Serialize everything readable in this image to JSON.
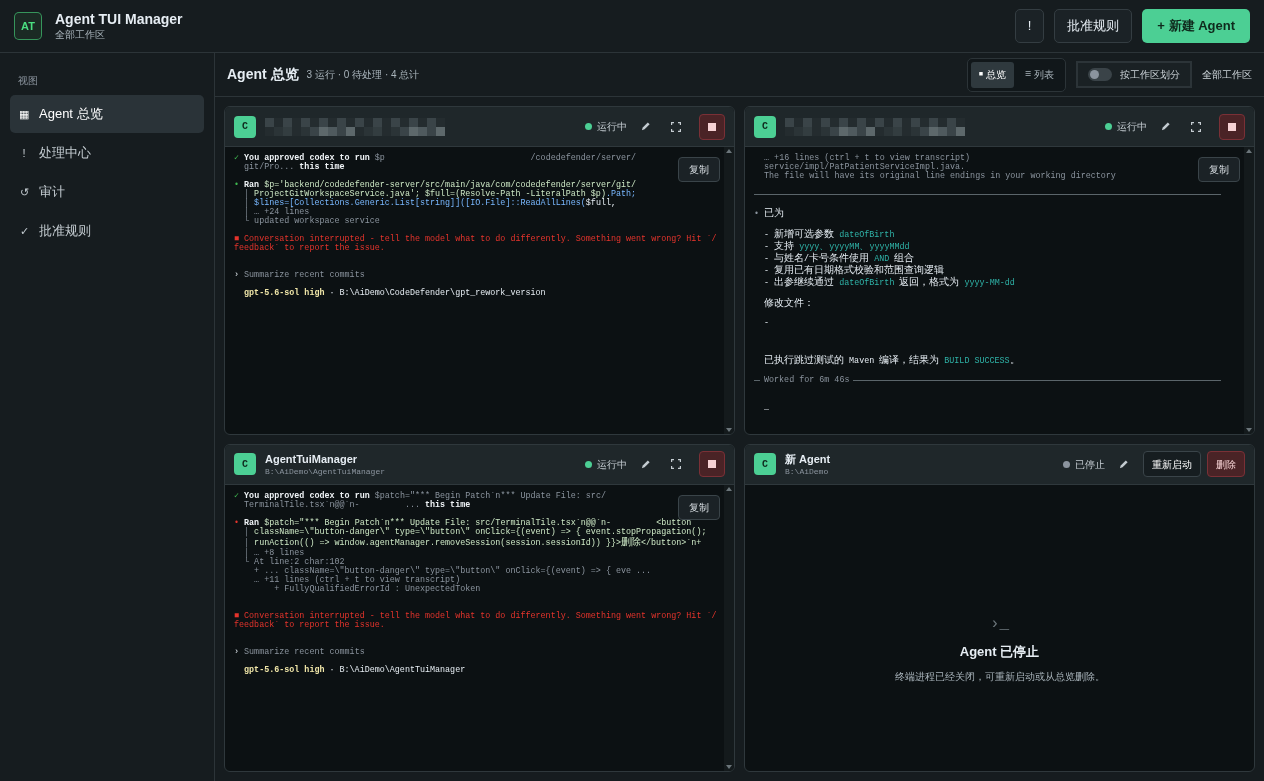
{
  "app": {
    "logo": "AT",
    "title": "Agent TUI Manager",
    "subtitle": "全部工作区"
  },
  "header_buttons": [
    {
      "label": "!",
      "kind": "plain"
    },
    {
      "label": "批准规则",
      "kind": "plain"
    },
    {
      "label": "+ 新建 Agent",
      "kind": "primary"
    }
  ],
  "sidebar": {
    "section": "视图",
    "items": [
      {
        "icon": "▦",
        "label": "Agent 总览",
        "selected": true
      },
      {
        "icon": "!",
        "label": "处理中心",
        "selected": false
      },
      {
        "icon": "↺",
        "label": "审计",
        "selected": false
      },
      {
        "icon": "✓",
        "label": "批准规则",
        "selected": false
      }
    ]
  },
  "toolbar": {
    "title": "Agent 总览",
    "summary": "3 运行 · 0 待处理 · 4 总计",
    "views": [
      {
        "icon": "■",
        "label": "总览",
        "selected": true
      },
      {
        "icon": "☰",
        "label": "列表",
        "selected": false
      }
    ],
    "group_toggle": {
      "label": "按工作区划分",
      "on": false
    },
    "workspace": "全部工作区"
  },
  "cards": [
    {
      "kind": "terminal",
      "avatar": "C",
      "redacted": true,
      "status": {
        "label": "运行中",
        "running": true
      },
      "copy": "复制",
      "lines": [
        {
          "kind": "text",
          "segments": [
            {
              "kind": "ok",
              "text": "✓ "
            },
            {
              "kind": "strong",
              "text": "You approved codex to run "
            },
            {
              "kind": "dim",
              "text": "$p                             /codedefender/server/"
            }
          ]
        },
        {
          "kind": "text",
          "segments": [
            {
              "kind": "dim",
              "text": "  git/Pro... "
            },
            {
              "kind": "strong",
              "text": "this time"
            }
          ]
        },
        {
          "kind": "blank"
        },
        {
          "kind": "text",
          "segments": [
            {
              "kind": "ok",
              "text": "• "
            },
            {
              "kind": "strong",
              "text": "Ran "
            },
            {
              "kind": "code",
              "text": "$p='backend/codedefender-server/src/main/java/com/codedefender/server/git/"
            }
          ]
        },
        {
          "kind": "text",
          "segments": [
            {
              "kind": "dim",
              "text": "  │ "
            },
            {
              "kind": "code",
              "text": "ProjectGitWorkspaceService.java'; $full=(Resolve-Path -LiteralPath $p)"
            },
            {
              "kind": "keyword",
              "text": ".Path;"
            }
          ]
        },
        {
          "kind": "text",
          "segments": [
            {
              "kind": "dim",
              "text": "  │ "
            },
            {
              "kind": "keyword",
              "text": "$lines=[Collections.Generic.List[string]]([IO.File]::ReadAllLines("
            },
            {
              "kind": "plain",
              "text": "$full,"
            }
          ]
        },
        {
          "kind": "text",
          "segments": [
            {
              "kind": "dim",
              "text": "  │ … +24 lines"
            }
          ]
        },
        {
          "kind": "text",
          "segments": [
            {
              "kind": "dim",
              "text": "  └ updated workspace service"
            }
          ]
        },
        {
          "kind": "blank"
        },
        {
          "kind": "text",
          "segments": [
            {
              "kind": "error",
              "text": "■ Conversation interrupted - tell the model what to do differently. Something went wrong? Hit `/"
            }
          ]
        },
        {
          "kind": "text",
          "segments": [
            {
              "kind": "error",
              "text": "feedback` to report the issue."
            }
          ]
        },
        {
          "kind": "blank"
        },
        {
          "kind": "blank"
        },
        {
          "kind": "text",
          "segments": [
            {
              "kind": "plain",
              "text": "› "
            },
            {
              "kind": "dim",
              "text": "Summarize recent commits"
            }
          ]
        },
        {
          "kind": "blank"
        },
        {
          "kind": "text",
          "segments": [
            {
              "kind": "model",
              "text": "  gpt-5.6-sol high"
            },
            {
              "kind": "plain",
              "text": " · B:\\AiDemo\\CodeDefender\\gpt_rework_version"
            }
          ]
        }
      ]
    },
    {
      "kind": "terminal",
      "avatar": "C",
      "redacted": true,
      "status": {
        "label": "运行中",
        "running": true
      },
      "copy": "复制",
      "lines": [
        {
          "kind": "text",
          "segments": [
            {
              "kind": "dim",
              "text": "  … +16 lines (ctrl + t to view transcript)"
            }
          ]
        },
        {
          "kind": "text",
          "segments": [
            {
              "kind": "dim",
              "text": "  service/impl/PatPatientServiceImpl.java."
            }
          ]
        },
        {
          "kind": "text",
          "segments": [
            {
              "kind": "dim",
              "text": "  The file will have its original line endings in your working directory"
            }
          ]
        },
        {
          "kind": "blank"
        },
        {
          "kind": "rule"
        },
        {
          "kind": "blank"
        },
        {
          "kind": "text",
          "segments": [
            {
              "kind": "dim",
              "text": "• "
            },
            {
              "kind": "plain",
              "text": "已为"
            }
          ]
        },
        {
          "kind": "blank"
        },
        {
          "kind": "text",
          "segments": [
            {
              "kind": "plain",
              "text": "  - 新增可选参数 "
            },
            {
              "kind": "accent",
              "text": "dateOfBirth"
            }
          ]
        },
        {
          "kind": "text",
          "segments": [
            {
              "kind": "plain",
              "text": "  - 支持 "
            },
            {
              "kind": "accent",
              "text": "yyyy、yyyyMM、yyyyMMdd"
            }
          ]
        },
        {
          "kind": "text",
          "segments": [
            {
              "kind": "plain",
              "text": "  - 与姓名/卡号条件使用 "
            },
            {
              "kind": "accent",
              "text": "AND"
            },
            {
              "kind": "plain",
              "text": " 组合"
            }
          ]
        },
        {
          "kind": "text",
          "segments": [
            {
              "kind": "plain",
              "text": "  - 复用已有日期格式校验和范围查询逻辑"
            }
          ]
        },
        {
          "kind": "text",
          "segments": [
            {
              "kind": "plain",
              "text": "  - 出参继续通过 "
            },
            {
              "kind": "accent",
              "text": "dateOfBirth"
            },
            {
              "kind": "plain",
              "text": " 返回，格式为 "
            },
            {
              "kind": "accent",
              "text": "yyyy-MM-dd"
            }
          ]
        },
        {
          "kind": "blank"
        },
        {
          "kind": "text",
          "segments": [
            {
              "kind": "plain",
              "text": "  修改文件："
            }
          ]
        },
        {
          "kind": "blank"
        },
        {
          "kind": "text",
          "segments": [
            {
              "kind": "plain",
              "text": "  -"
            }
          ]
        },
        {
          "kind": "blank"
        },
        {
          "kind": "blank"
        },
        {
          "kind": "blank"
        },
        {
          "kind": "text",
          "segments": [
            {
              "kind": "plain",
              "text": "  已执行跳过测试的 Maven 编译，结果为 "
            },
            {
              "kind": "accent",
              "text": "BUILD SUCCESS"
            },
            {
              "kind": "plain",
              "text": "。"
            }
          ]
        },
        {
          "kind": "blank"
        },
        {
          "kind": "rule",
          "label": "Worked for 6m 46s"
        },
        {
          "kind": "blank"
        },
        {
          "kind": "blank"
        },
        {
          "kind": "text",
          "segments": [
            {
              "kind": "plain",
              "text": "  _"
            }
          ]
        }
      ]
    },
    {
      "kind": "terminal",
      "avatar": "C",
      "redacted": false,
      "title": "AgentTuiManager",
      "path": "B:\\AiDemo\\AgentTuiManager",
      "status": {
        "label": "运行中",
        "running": true
      },
      "copy": "复制",
      "lines": [
        {
          "kind": "text",
          "segments": [
            {
              "kind": "ok",
              "text": "✓ "
            },
            {
              "kind": "strong",
              "text": "You approved codex to run "
            },
            {
              "kind": "dim",
              "text": "$patch=\"*** Begin Patch`n*** Update File: src/"
            }
          ]
        },
        {
          "kind": "text",
          "segments": [
            {
              "kind": "dim",
              "text": "  TerminalTile.tsx`n@@`n-         ... "
            },
            {
              "kind": "strong",
              "text": "this time"
            }
          ]
        },
        {
          "kind": "blank"
        },
        {
          "kind": "text",
          "segments": [
            {
              "kind": "error",
              "text": "• "
            },
            {
              "kind": "strong",
              "text": "Ran "
            },
            {
              "kind": "code",
              "text": "$patch=\"*** Begin Patch`n*** Update File: src/TerminalTile.tsx`n@@`n-         <button"
            }
          ]
        },
        {
          "kind": "text",
          "segments": [
            {
              "kind": "dim",
              "text": "  │ "
            },
            {
              "kind": "code",
              "text": "className=\\\"button-danger\\\" type=\\\"button\\\" onClick={(event) => { event.stopPropagation();"
            }
          ]
        },
        {
          "kind": "text",
          "segments": [
            {
              "kind": "dim",
              "text": "  │ "
            },
            {
              "kind": "code",
              "text": "runAction(() => window.agentManager.removeSession(session.sessionId)) }}>删除</button>`n+"
            }
          ]
        },
        {
          "kind": "text",
          "segments": [
            {
              "kind": "dim",
              "text": "  │ … +8 lines"
            }
          ]
        },
        {
          "kind": "text",
          "segments": [
            {
              "kind": "dim",
              "text": "  └ At line:2 char:102"
            }
          ]
        },
        {
          "kind": "text",
          "segments": [
            {
              "kind": "dim",
              "text": "    + ... className=\\\"button-danger\\\" type=\\\"button\\\" onClick={(event) => { eve ..."
            }
          ]
        },
        {
          "kind": "text",
          "segments": [
            {
              "kind": "dim",
              "text": "    … +11 lines (ctrl + t to view transcript)"
            }
          ]
        },
        {
          "kind": "text",
          "segments": [
            {
              "kind": "dim",
              "text": "        + FullyQualifiedErrorId : UnexpectedToken"
            }
          ]
        },
        {
          "kind": "blank"
        },
        {
          "kind": "blank"
        },
        {
          "kind": "text",
          "segments": [
            {
              "kind": "error",
              "text": "■ Conversation interrupted - tell the model what to do differently. Something went wrong? Hit `/"
            }
          ]
        },
        {
          "kind": "text",
          "segments": [
            {
              "kind": "error",
              "text": "feedback` to report the issue."
            }
          ]
        },
        {
          "kind": "blank"
        },
        {
          "kind": "blank"
        },
        {
          "kind": "text",
          "segments": [
            {
              "kind": "plain",
              "text": "› "
            },
            {
              "kind": "dim",
              "text": "Summarize recent commits"
            }
          ]
        },
        {
          "kind": "blank"
        },
        {
          "kind": "text",
          "segments": [
            {
              "kind": "model",
              "text": "  gpt-5.6-sol high"
            },
            {
              "kind": "plain",
              "text": " · B:\\AiDemo\\AgentTuiManager"
            }
          ]
        }
      ]
    },
    {
      "kind": "stopped",
      "avatar": "C",
      "redacted": false,
      "title": "新 Agent",
      "path": "B:\\AiDemo",
      "status": {
        "label": "已停止",
        "running": false
      },
      "restart": "重新启动",
      "delete": "删除",
      "prompt": "›_",
      "message": "Agent 已停止",
      "hint": "终端进程已经关闭，可重新启动或从总览删除。"
    }
  ]
}
